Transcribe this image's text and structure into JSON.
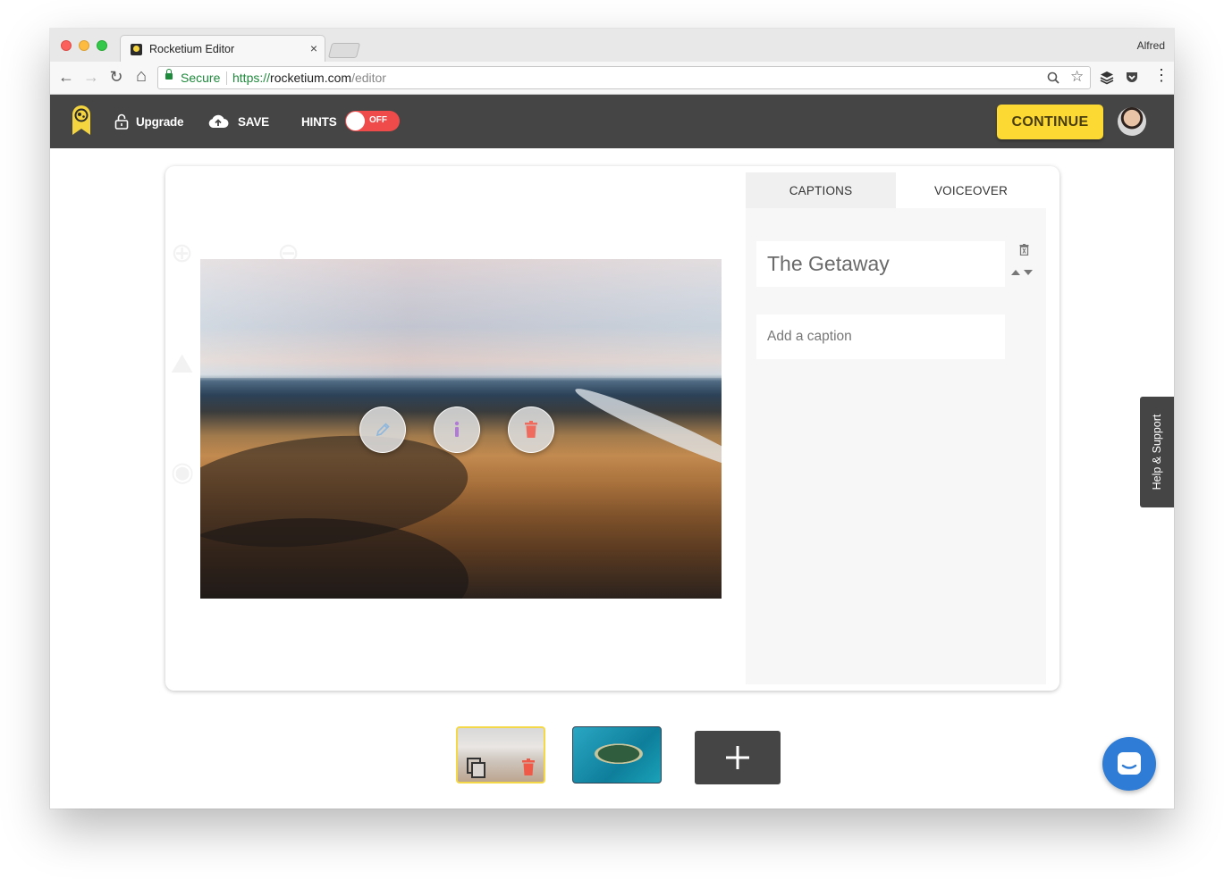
{
  "browser": {
    "tab_title": "Rocketium Editor",
    "tab_close": "×",
    "profile_name": "Alfred",
    "secure_label": "Secure",
    "url_scheme": "https://",
    "url_host": "rocketium.com",
    "url_path": "/editor",
    "nav_icons": [
      "back-arrow-icon",
      "forward-arrow-icon",
      "reload-icon",
      "home-icon"
    ],
    "back_glyph": "←",
    "forward_glyph": "→",
    "reload_glyph": "↻",
    "home_glyph": "⌂",
    "zoom_glyph": "🔍",
    "star_glyph": "☆",
    "menu_glyph": "⋮"
  },
  "appbar": {
    "upgrade_label": "Upgrade",
    "save_label": "SAVE",
    "hints_label": "HINTS",
    "hints_toggle_text": "OFF",
    "continue_label": "CONTINUE",
    "brand_color": "#fcd933",
    "toggle_color": "#ef4b4b"
  },
  "panel": {
    "tabs": [
      {
        "label": "CAPTIONS"
      },
      {
        "label": "VOICEOVER"
      }
    ],
    "caption_value": "The Getaway",
    "caption_placeholder": "Add a caption"
  },
  "help_label": "Help & Support",
  "add_slide_glyph": "+"
}
